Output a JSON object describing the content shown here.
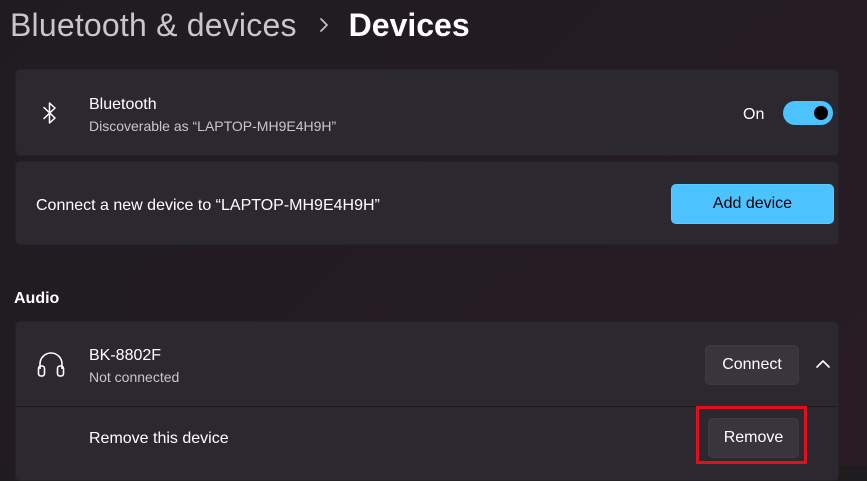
{
  "breadcrumb": {
    "parent": "Bluetooth & devices",
    "separator": "›",
    "current": "Devices"
  },
  "bluetooth": {
    "icon": "bluetooth-icon",
    "title": "Bluetooth",
    "subtitle": "Discoverable as “LAPTOP-MH9E4H9H”",
    "toggle_label": "On",
    "toggle_state": "on"
  },
  "add_device": {
    "text": "Connect a new device to “LAPTOP-MH9E4H9H”",
    "button_label": "Add device"
  },
  "audio": {
    "section_label": "Audio",
    "device": {
      "icon": "headphones-icon",
      "name": "BK-8802F",
      "status": "Not connected",
      "connect_label": "Connect",
      "expand_icon": "chevron-up-icon"
    },
    "remove": {
      "text": "Remove this device",
      "button_label": "Remove"
    }
  },
  "colors": {
    "accent": "#4cc2ff",
    "highlight": "#e1101e",
    "card": "#2c2830"
  }
}
